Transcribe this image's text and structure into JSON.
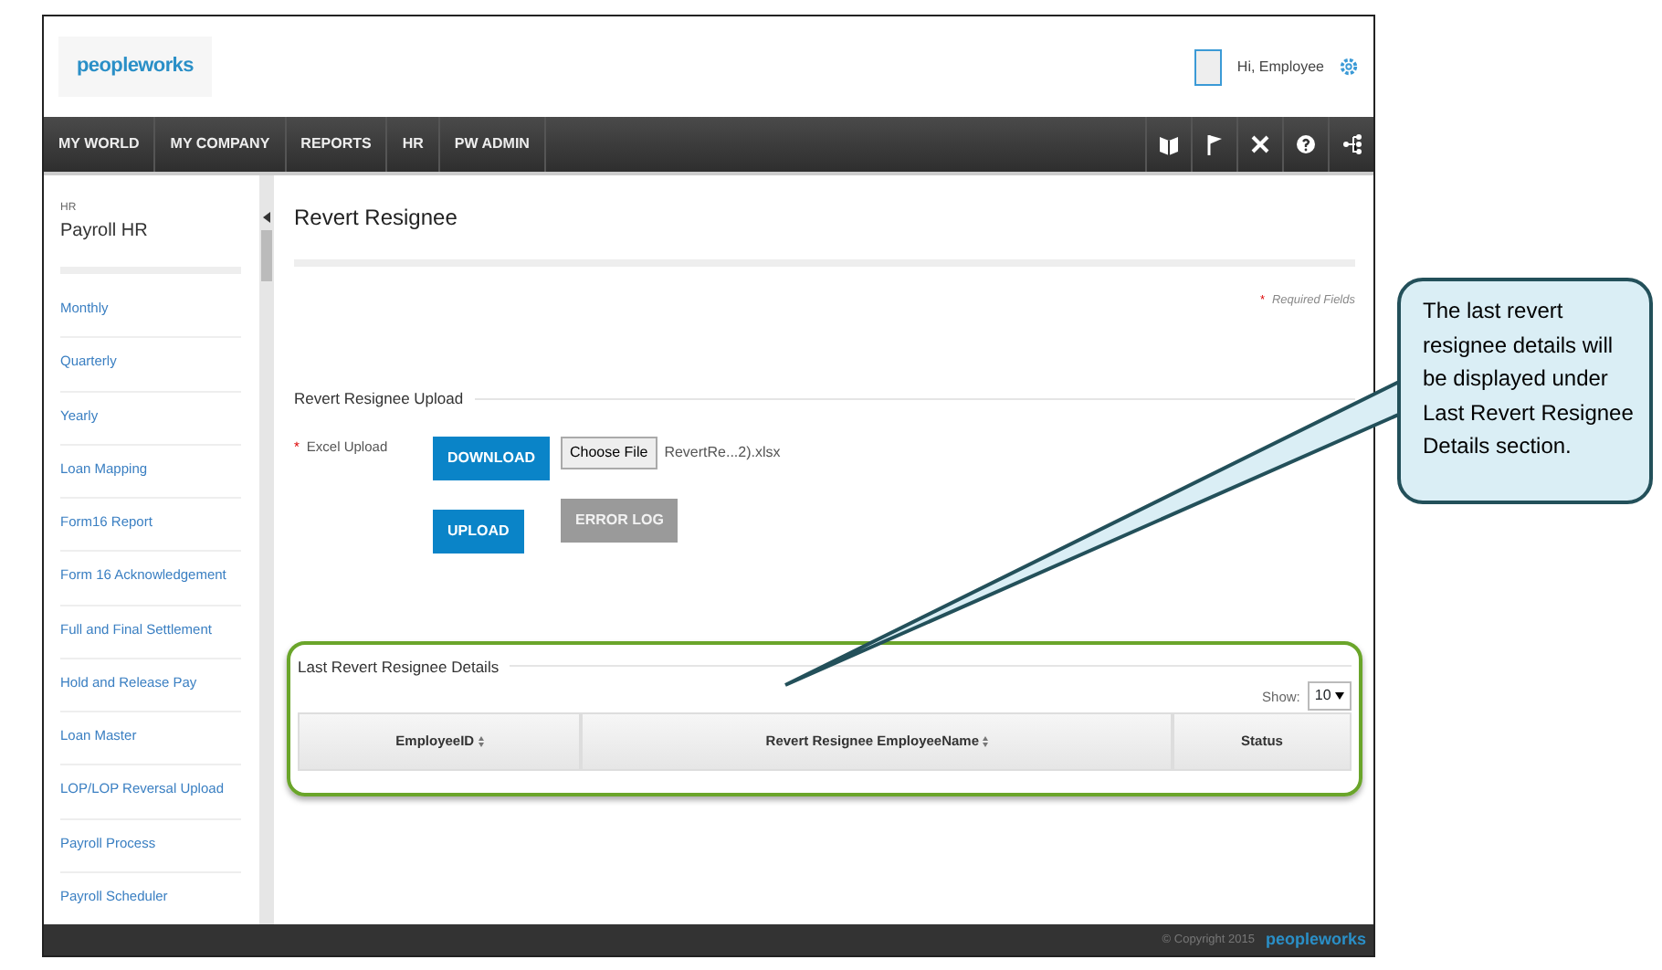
{
  "header": {
    "logo": "peopleworks",
    "greeting": "Hi, Employee"
  },
  "nav": {
    "items": [
      "MY WORLD",
      "MY COMPANY",
      "REPORTS",
      "HR",
      "PW ADMIN"
    ]
  },
  "sidebar": {
    "module": "HR",
    "title": "Payroll HR",
    "items": [
      "Monthly",
      "Quarterly",
      "Yearly",
      "Loan Mapping",
      "Form16 Report",
      "Form 16 Acknowledgement",
      "Full and Final Settlement",
      "Hold and Release Pay",
      "Loan Master",
      "LOP/LOP Reversal Upload",
      "Payroll Process",
      "Payroll Scheduler"
    ]
  },
  "page": {
    "title": "Revert Resignee",
    "required_mark": "*",
    "required_note": "Required Fields"
  },
  "upload": {
    "title": "Revert Resignee Upload",
    "required_mark": "*",
    "field_label": "Excel Upload",
    "buttons": [
      {
        "label": "DOWNLOAD",
        "disabled": false
      },
      {
        "label": "UPLOAD",
        "disabled": false
      },
      {
        "label": "ERROR LOG",
        "disabled": true
      }
    ],
    "file": {
      "button": "Choose File",
      "name": "RevertRe...2).xlsx"
    }
  },
  "details": {
    "title": "Last Revert Resignee Details",
    "highlighted": true,
    "show_label": "Show:",
    "page_size": "10",
    "columns": [
      {
        "label": "EmployeeID",
        "sortable": true
      },
      {
        "label": "Revert Resignee EmployeeName",
        "sortable": true
      },
      {
        "label": "Status",
        "sortable": false
      }
    ]
  },
  "footer": {
    "copyright": "© Copyright 2015",
    "logo": "peopleworks"
  },
  "callout": {
    "text": "The last revert resignee details will be displayed under Last Revert Resignee Details section."
  }
}
